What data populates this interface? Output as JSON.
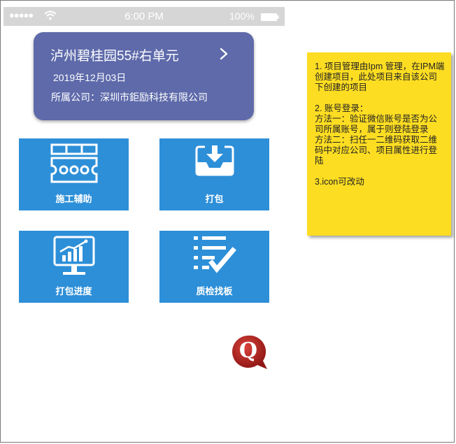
{
  "status_bar": {
    "signal": "●●●●●",
    "time": "6:00 PM",
    "battery": "100%"
  },
  "project": {
    "title": "泸州碧桂园55#右单元",
    "date": "2019年12月03日",
    "company": "所属公司：深圳市鉅励科技有限公司"
  },
  "tiles": [
    {
      "label": "施工辅助",
      "icon": "construction-assist-icon"
    },
    {
      "label": "打包",
      "icon": "package-tray-icon"
    },
    {
      "label": "打包进度",
      "icon": "progress-chart-monitor-icon"
    },
    {
      "label": "质检找板",
      "icon": "checklist-icon"
    }
  ],
  "floating_badge": {
    "letter": "Q"
  },
  "note": {
    "text": "1. 项目管理由Ipm 管理，在IPM端创建项目，此处项目来自该公司下创建的项目\n\n2. 账号登录：\n方法一：验证微信账号是否为公司所属账号，属于则登陆登录\n方法二：扫任一二维码获取二维码中对应公司、项目属性进行登陆\n\n3.icon可改动"
  },
  "colors": {
    "card": "#5e6aaa",
    "tile": "#2d8fd8",
    "note": "#fddd22",
    "badge": "#b9201e"
  }
}
